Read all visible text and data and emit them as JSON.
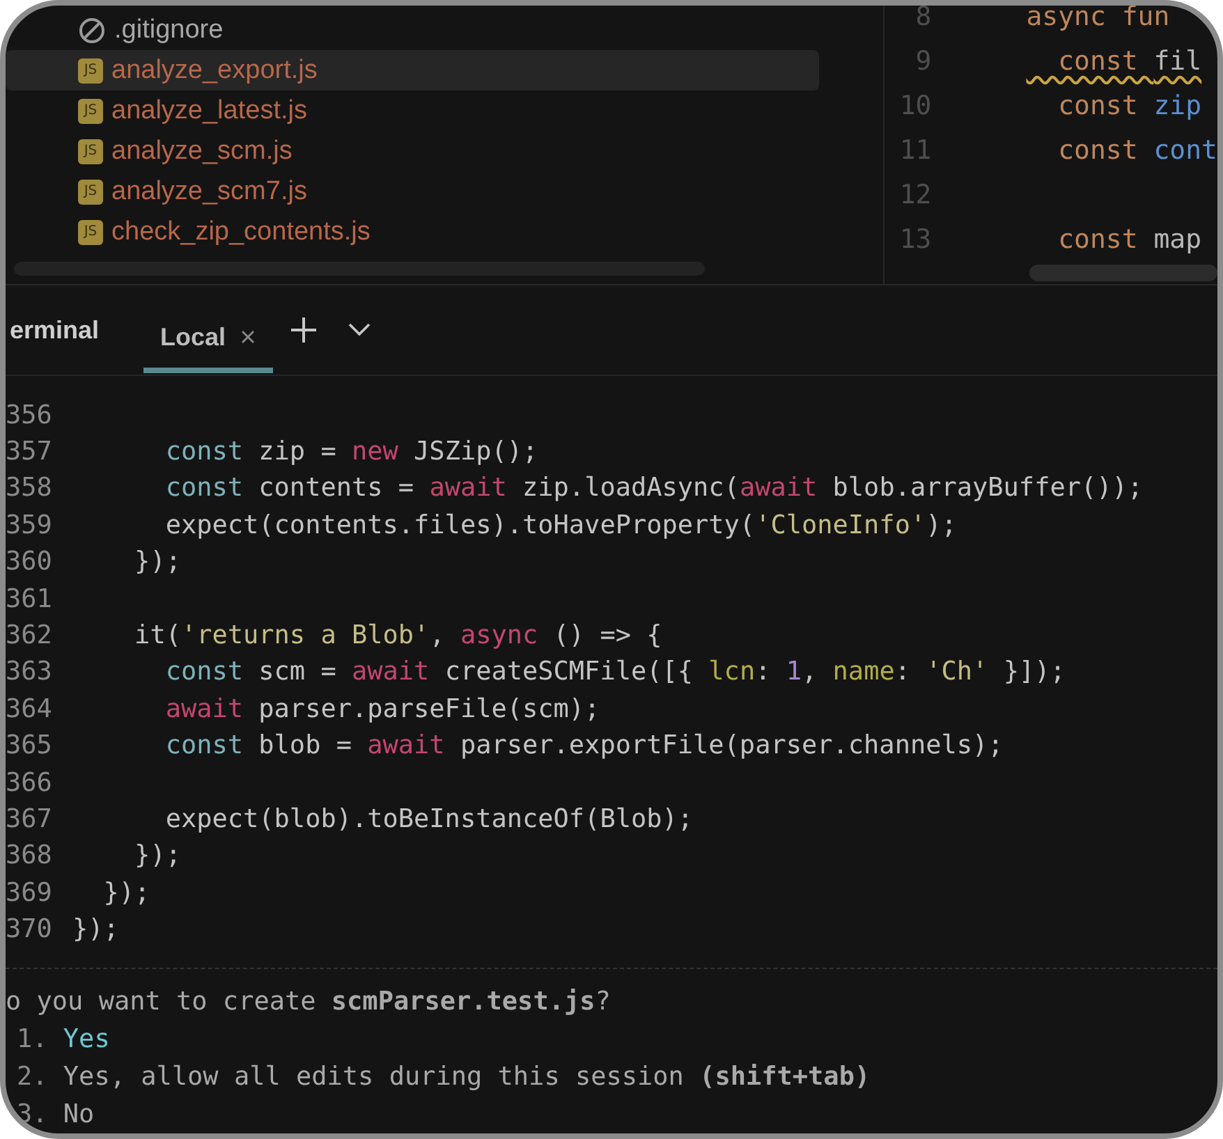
{
  "file_tree": {
    "items": [
      {
        "name": ".gitignore",
        "kind": "ignore",
        "selected": false
      },
      {
        "name": "analyze_export.js",
        "kind": "js",
        "badge": "JS",
        "selected": true
      },
      {
        "name": "analyze_latest.js",
        "kind": "js",
        "badge": "JS",
        "selected": false
      },
      {
        "name": "analyze_scm.js",
        "kind": "js",
        "badge": "JS",
        "selected": false
      },
      {
        "name": "analyze_scm7.js",
        "kind": "js",
        "badge": "JS",
        "selected": false
      },
      {
        "name": "check_zip_contents.js",
        "kind": "js",
        "badge": "JS",
        "selected": false
      }
    ]
  },
  "editor": {
    "lines": [
      {
        "number": "8",
        "warning": false,
        "tokens": [
          {
            "kind": "kw",
            "text": "async fun"
          }
        ]
      },
      {
        "number": "9",
        "warning": true,
        "tokens": [
          {
            "kind": "kw",
            "text": "  const "
          },
          {
            "kind": "plain",
            "text": "fil"
          }
        ]
      },
      {
        "number": "10",
        "warning": false,
        "tokens": [
          {
            "kind": "kw",
            "text": "  const "
          },
          {
            "kind": "var",
            "text": "zip"
          }
        ]
      },
      {
        "number": "11",
        "warning": false,
        "tokens": [
          {
            "kind": "kw",
            "text": "  const "
          },
          {
            "kind": "var",
            "text": "cont"
          }
        ]
      },
      {
        "number": "12"
      },
      {
        "number": "13",
        "warning": false,
        "tokens": [
          {
            "kind": "kw",
            "text": "  const "
          },
          {
            "kind": "plain",
            "text": "map"
          }
        ]
      }
    ]
  },
  "terminal": {
    "title": "erminal",
    "tabs": [
      {
        "label": "Local",
        "selected": true
      }
    ],
    "lines": [
      {
        "number": "356"
      },
      {
        "number": "357",
        "tokens": [
          {
            "kind": "decl",
            "text": "      const "
          },
          {
            "kind": "plain",
            "text": "zip = "
          },
          {
            "kind": "kw",
            "text": "new "
          },
          {
            "kind": "plain",
            "text": "JSZip();"
          }
        ]
      },
      {
        "number": "358",
        "tokens": [
          {
            "kind": "decl",
            "text": "      const "
          },
          {
            "kind": "plain",
            "text": "contents = "
          },
          {
            "kind": "kw",
            "text": "await "
          },
          {
            "kind": "plain",
            "text": "zip.loadAsync("
          },
          {
            "kind": "kw",
            "text": "await "
          },
          {
            "kind": "plain",
            "text": "blob.arrayBuffer());"
          }
        ]
      },
      {
        "number": "359",
        "tokens": [
          {
            "kind": "plain",
            "text": "      expect(contents.files).toHaveProperty("
          },
          {
            "kind": "str",
            "text": "'CloneInfo'"
          },
          {
            "kind": "plain",
            "text": ");"
          }
        ]
      },
      {
        "number": "360",
        "tokens": [
          {
            "kind": "plain",
            "text": "    });"
          }
        ]
      },
      {
        "number": "361"
      },
      {
        "number": "362",
        "tokens": [
          {
            "kind": "plain",
            "text": "    it("
          },
          {
            "kind": "str",
            "text": "'returns a Blob'"
          },
          {
            "kind": "plain",
            "text": ", "
          },
          {
            "kind": "kw",
            "text": "async "
          },
          {
            "kind": "plain",
            "text": "() => {"
          }
        ]
      },
      {
        "number": "363",
        "tokens": [
          {
            "kind": "decl",
            "text": "      const "
          },
          {
            "kind": "plain",
            "text": "scm = "
          },
          {
            "kind": "kw",
            "text": "await "
          },
          {
            "kind": "plain",
            "text": "createSCMFile([{ "
          },
          {
            "kind": "prop",
            "text": "lcn"
          },
          {
            "kind": "plain",
            "text": ": "
          },
          {
            "kind": "num",
            "text": "1"
          },
          {
            "kind": "plain",
            "text": ", "
          },
          {
            "kind": "prop",
            "text": "name"
          },
          {
            "kind": "plain",
            "text": ": "
          },
          {
            "kind": "str",
            "text": "'Ch'"
          },
          {
            "kind": "plain",
            "text": " }]);"
          }
        ]
      },
      {
        "number": "364",
        "tokens": [
          {
            "kind": "kw",
            "text": "      await "
          },
          {
            "kind": "plain",
            "text": "parser.parseFile(scm);"
          }
        ]
      },
      {
        "number": "365",
        "tokens": [
          {
            "kind": "decl",
            "text": "      const "
          },
          {
            "kind": "plain",
            "text": "blob = "
          },
          {
            "kind": "kw",
            "text": "await "
          },
          {
            "kind": "plain",
            "text": "parser.exportFile(parser.channels);"
          }
        ]
      },
      {
        "number": "366"
      },
      {
        "number": "367",
        "tokens": [
          {
            "kind": "plain",
            "text": "      expect(blob).toBeInstanceOf(Blob);"
          }
        ]
      },
      {
        "number": "368",
        "tokens": [
          {
            "kind": "plain",
            "text": "    });"
          }
        ]
      },
      {
        "number": "369",
        "tokens": [
          {
            "kind": "plain",
            "text": "  });"
          }
        ]
      },
      {
        "number": "370",
        "tokens": [
          {
            "kind": "plain",
            "text": "});"
          }
        ]
      }
    ],
    "prompt": {
      "question": "o you want to create **scmParser.test.js**?",
      "options": [
        {
          "number": "1.",
          "label": "Yes",
          "selected": true
        },
        {
          "number": "2.",
          "label": "Yes, allow all edits during this session **(shift+tab)**",
          "selected": false
        },
        {
          "number": "3.",
          "label": "No",
          "selected": false
        }
      ]
    }
  }
}
